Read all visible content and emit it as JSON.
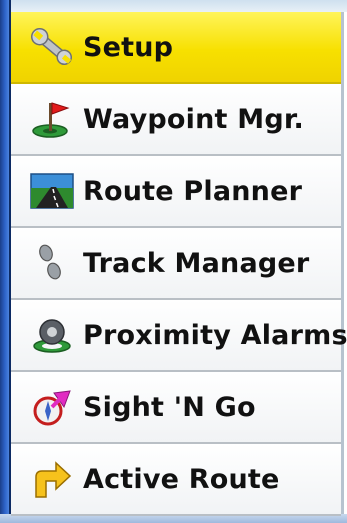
{
  "menu": {
    "items": [
      {
        "label": "Setup",
        "icon": "wrench-icon",
        "selected": true
      },
      {
        "label": "Waypoint Mgr.",
        "icon": "flag-icon",
        "selected": false
      },
      {
        "label": "Route Planner",
        "icon": "road-icon",
        "selected": false
      },
      {
        "label": "Track Manager",
        "icon": "footprints-icon",
        "selected": false
      },
      {
        "label": "Proximity Alarms",
        "icon": "alarm-icon",
        "selected": false
      },
      {
        "label": "Sight 'N Go",
        "icon": "compass-icon",
        "selected": false
      },
      {
        "label": "Active Route",
        "icon": "turn-arrow-icon",
        "selected": false
      }
    ]
  },
  "colors": {
    "selected_bg": "#f7e000",
    "frame_blue": "#2d63c9",
    "text": "#111111"
  }
}
